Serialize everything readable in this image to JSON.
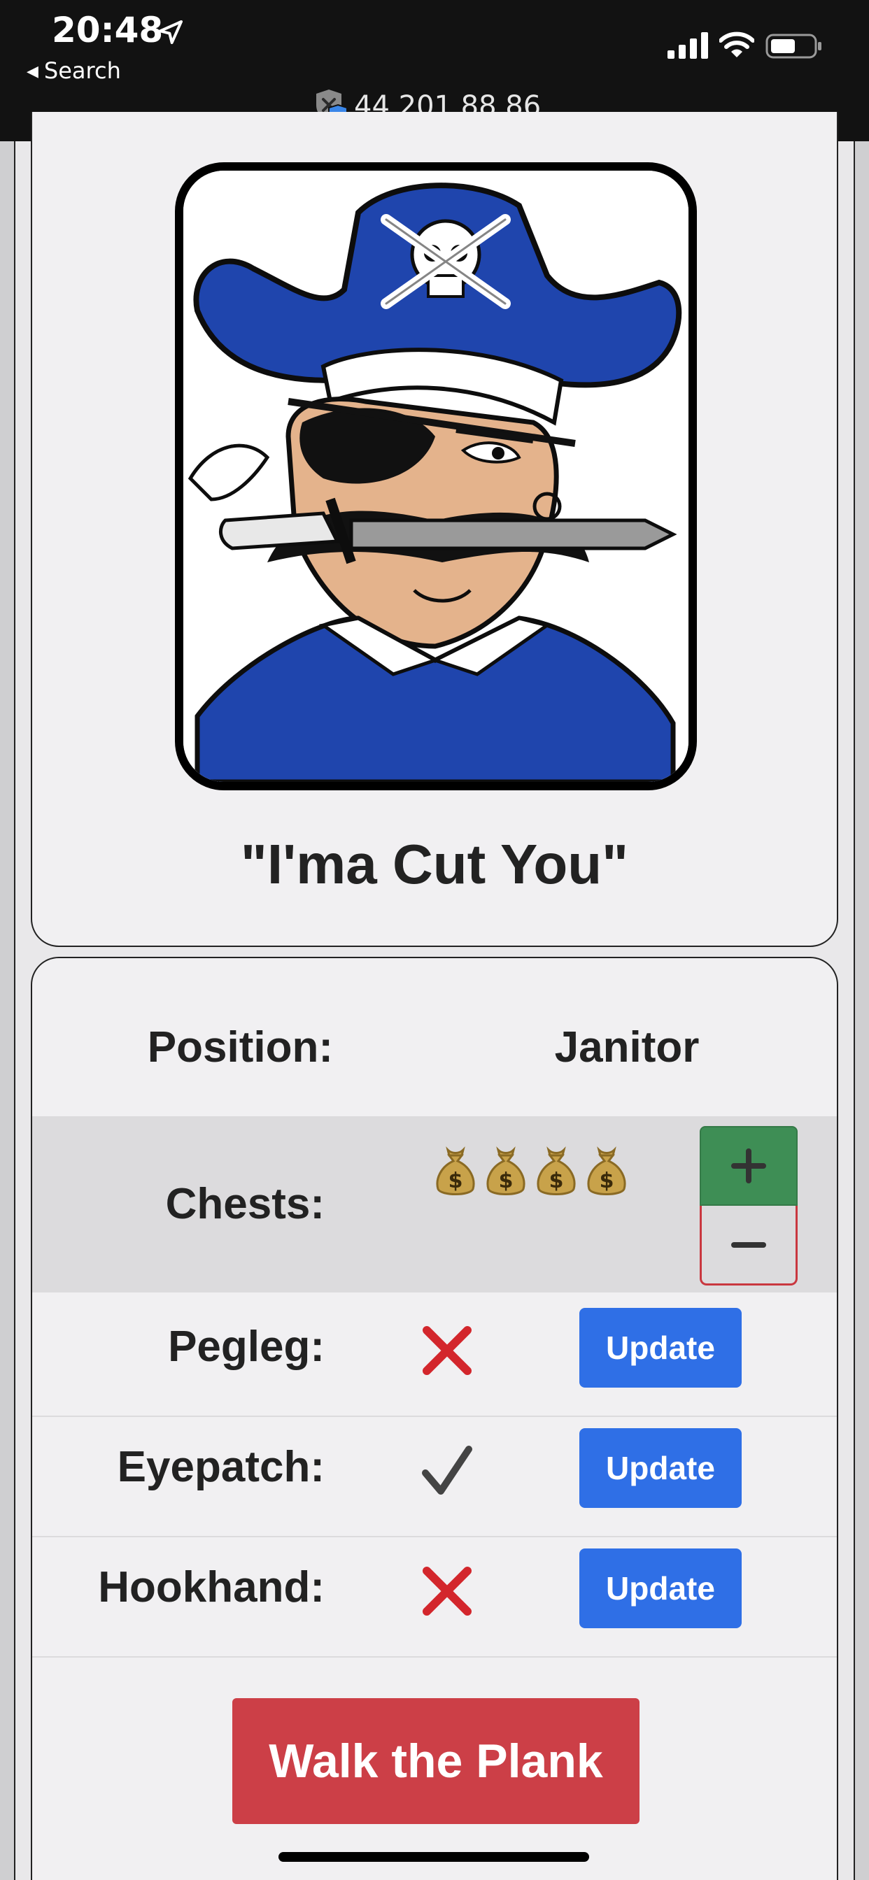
{
  "status_bar": {
    "time": "20:48",
    "back_label": "Search",
    "url": "44.201.88.86"
  },
  "profile": {
    "nickname": "\"I'ma Cut You\""
  },
  "stats": {
    "position_label": "Position:",
    "position_value": "Janitor",
    "chests_label": "Chests:",
    "chest_count": 4,
    "chest_icon": "money-bag-icon",
    "plus_label": "+",
    "minus_label": "−",
    "rows": [
      {
        "label": "Pegleg:",
        "has_item": false,
        "button": "Update"
      },
      {
        "label": "Eyepatch:",
        "has_item": true,
        "button": "Update"
      },
      {
        "label": "Hookhand:",
        "has_item": false,
        "button": "Update"
      }
    ]
  },
  "actions": {
    "walk_plank": "Walk the Plank"
  },
  "colors": {
    "update_blue": "#2f6fe6",
    "plus_green": "#3e8e55",
    "danger_red": "#cc3f47",
    "cross_red": "#d3262c"
  }
}
